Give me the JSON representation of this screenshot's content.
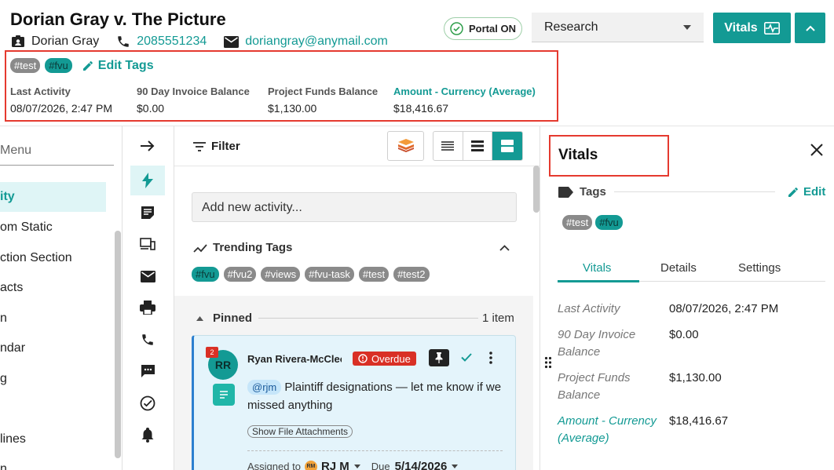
{
  "header": {
    "case_title": "Dorian Gray v. The Picture",
    "contact_name": "Dorian Gray",
    "phone": "2085551234",
    "email": "doriangray@anymail.com",
    "portal_label": "Portal ON",
    "phase_select": "Research",
    "vitals_button": "Vitals",
    "tags": [
      "#test",
      "#fvu"
    ],
    "edit_tags": "Edit Tags",
    "stats": [
      {
        "label": "Last Activity",
        "value": "08/07/2026, 2:47 PM"
      },
      {
        "label": "90 Day Invoice Balance",
        "value": "$0.00"
      },
      {
        "label": "Project Funds Balance",
        "value": "$1,130.00"
      },
      {
        "label": "Amount - Currency (Average)",
        "value": "$18,416.67"
      }
    ]
  },
  "left_nav": {
    "search_placeholder": "Menu",
    "items": [
      "ity",
      "om Static",
      "ction Section",
      "acts",
      "n",
      "ndar",
      "g",
      "",
      "lines",
      "n"
    ]
  },
  "activity": {
    "filter_label": "Filter",
    "add_placeholder": "Add new activity...",
    "trending_title": "Trending Tags",
    "trending_tags": [
      "#fvu",
      "#fvu2",
      "#views",
      "#fvu-task",
      "#test",
      "#test2"
    ],
    "pinned_label": "Pinned",
    "pinned_count": "1 item",
    "card": {
      "badge": "2",
      "initials": "RR",
      "author": "Ryan Rivera-McCleod",
      "status": "Overdue",
      "mention": "@rjm",
      "text": " Plaintiff designations — let me know if we missed anything",
      "attachments_label": "Show File Attachments",
      "assigned_label": "Assigned to",
      "assignee_initials": "RM",
      "assignee": "RJ M",
      "due_label": "Due",
      "due_date": "5/14/2026"
    }
  },
  "vitals_panel": {
    "title": "Vitals",
    "tags_label": "Tags",
    "edit_label": "Edit",
    "tags": [
      "#test",
      "#fvu"
    ],
    "tabs": [
      "Vitals",
      "Details",
      "Settings"
    ],
    "rows": [
      {
        "label": "Last Activity",
        "value": "08/07/2026, 2:47 PM"
      },
      {
        "label": "90 Day Invoice Balance",
        "value": "$0.00"
      },
      {
        "label": "Project Funds Balance",
        "value": "$1,130.00"
      },
      {
        "label": "Amount - Currency (Average)",
        "value": "$18,416.67"
      }
    ]
  },
  "colors": {
    "accent": "#139a94",
    "danger": "#d93025",
    "highlight": "#e53a2f"
  }
}
